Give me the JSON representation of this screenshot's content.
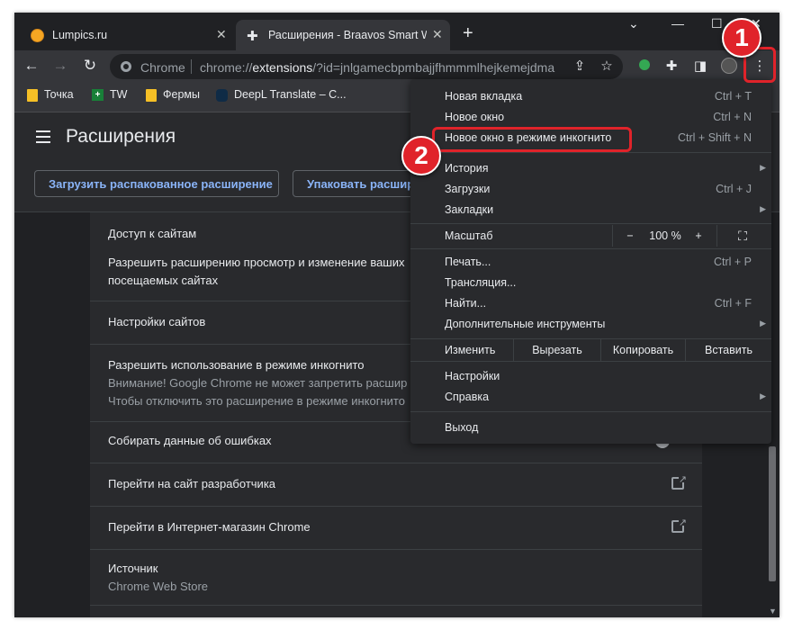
{
  "tabs": [
    {
      "title": "Lumpics.ru",
      "close": "✕"
    },
    {
      "title": "Расширения - Braavos Smart Wa",
      "close": "✕"
    }
  ],
  "new_tab": "+",
  "window_controls": {
    "minimize": "—",
    "maximize": "☐",
    "close": "✕",
    "dropdown": "⌄"
  },
  "toolbar": {
    "site_label": "Chrome",
    "url_prefix": "chrome://",
    "url_host": "extensions",
    "url_rest": "/?id=jnlgamecbpmbajjfhmmmlhejkemejdma"
  },
  "bookmarks": [
    {
      "label": "Точка",
      "icon": "folder-icon"
    },
    {
      "label": "TW",
      "icon": "tw-icon"
    },
    {
      "label": "Фермы",
      "icon": "folder-icon"
    },
    {
      "label": "DeepL Translate – C...",
      "icon": "deepl-icon"
    }
  ],
  "page": {
    "title": "Расширения",
    "load_unpacked": "Загрузить распакованное расширение",
    "pack_extension": "Упаковать расширение"
  },
  "settings": {
    "site_access_title": "Доступ к сайтам",
    "site_access_desc_1": "Разрешить расширению просмотр и изменение ваших",
    "site_access_desc_2": "посещаемых сайтах",
    "site_settings": "Настройки сайтов",
    "incognito_title": "Разрешить использование в режиме инкогнито",
    "incognito_desc_1": "Внимание! Google Chrome не может запретить расшир",
    "incognito_desc_2": "Чтобы отключить это расширение в режиме инкогнито",
    "collect_errors": "Собирать данные об ошибках",
    "developer_site": "Перейти на сайт разработчика",
    "chrome_store": "Перейти в Интернет-магазин Chrome",
    "source_title": "Источник",
    "source_value": "Chrome Web Store"
  },
  "menu": {
    "new_tab": {
      "label": "Новая вкладка",
      "shortcut": "Ctrl + T"
    },
    "new_window": {
      "label": "Новое окно",
      "shortcut": "Ctrl + N"
    },
    "incognito": {
      "label": "Новое окно в режиме инкогнито",
      "shortcut": "Ctrl + Shift + N"
    },
    "history": {
      "label": "История"
    },
    "downloads": {
      "label": "Загрузки",
      "shortcut": "Ctrl + J"
    },
    "bookmarks": {
      "label": "Закладки"
    },
    "zoom": {
      "label": "Масштаб",
      "minus": "−",
      "value": "100 %",
      "plus": "+"
    },
    "print": {
      "label": "Печать...",
      "shortcut": "Ctrl + P"
    },
    "cast": {
      "label": "Трансляция..."
    },
    "find": {
      "label": "Найти...",
      "shortcut": "Ctrl + F"
    },
    "more_tools": {
      "label": "Дополнительные инструменты"
    },
    "edit": {
      "label": "Изменить",
      "cut": "Вырезать",
      "copy": "Копировать",
      "paste": "Вставить"
    },
    "settings": {
      "label": "Настройки"
    },
    "help": {
      "label": "Справка"
    },
    "exit": {
      "label": "Выход"
    }
  },
  "annotations": {
    "step1": "1",
    "step2": "2"
  },
  "colors": {
    "highlight": "#e0232a",
    "link_blue": "#8ab4f8",
    "background": "#202124"
  }
}
